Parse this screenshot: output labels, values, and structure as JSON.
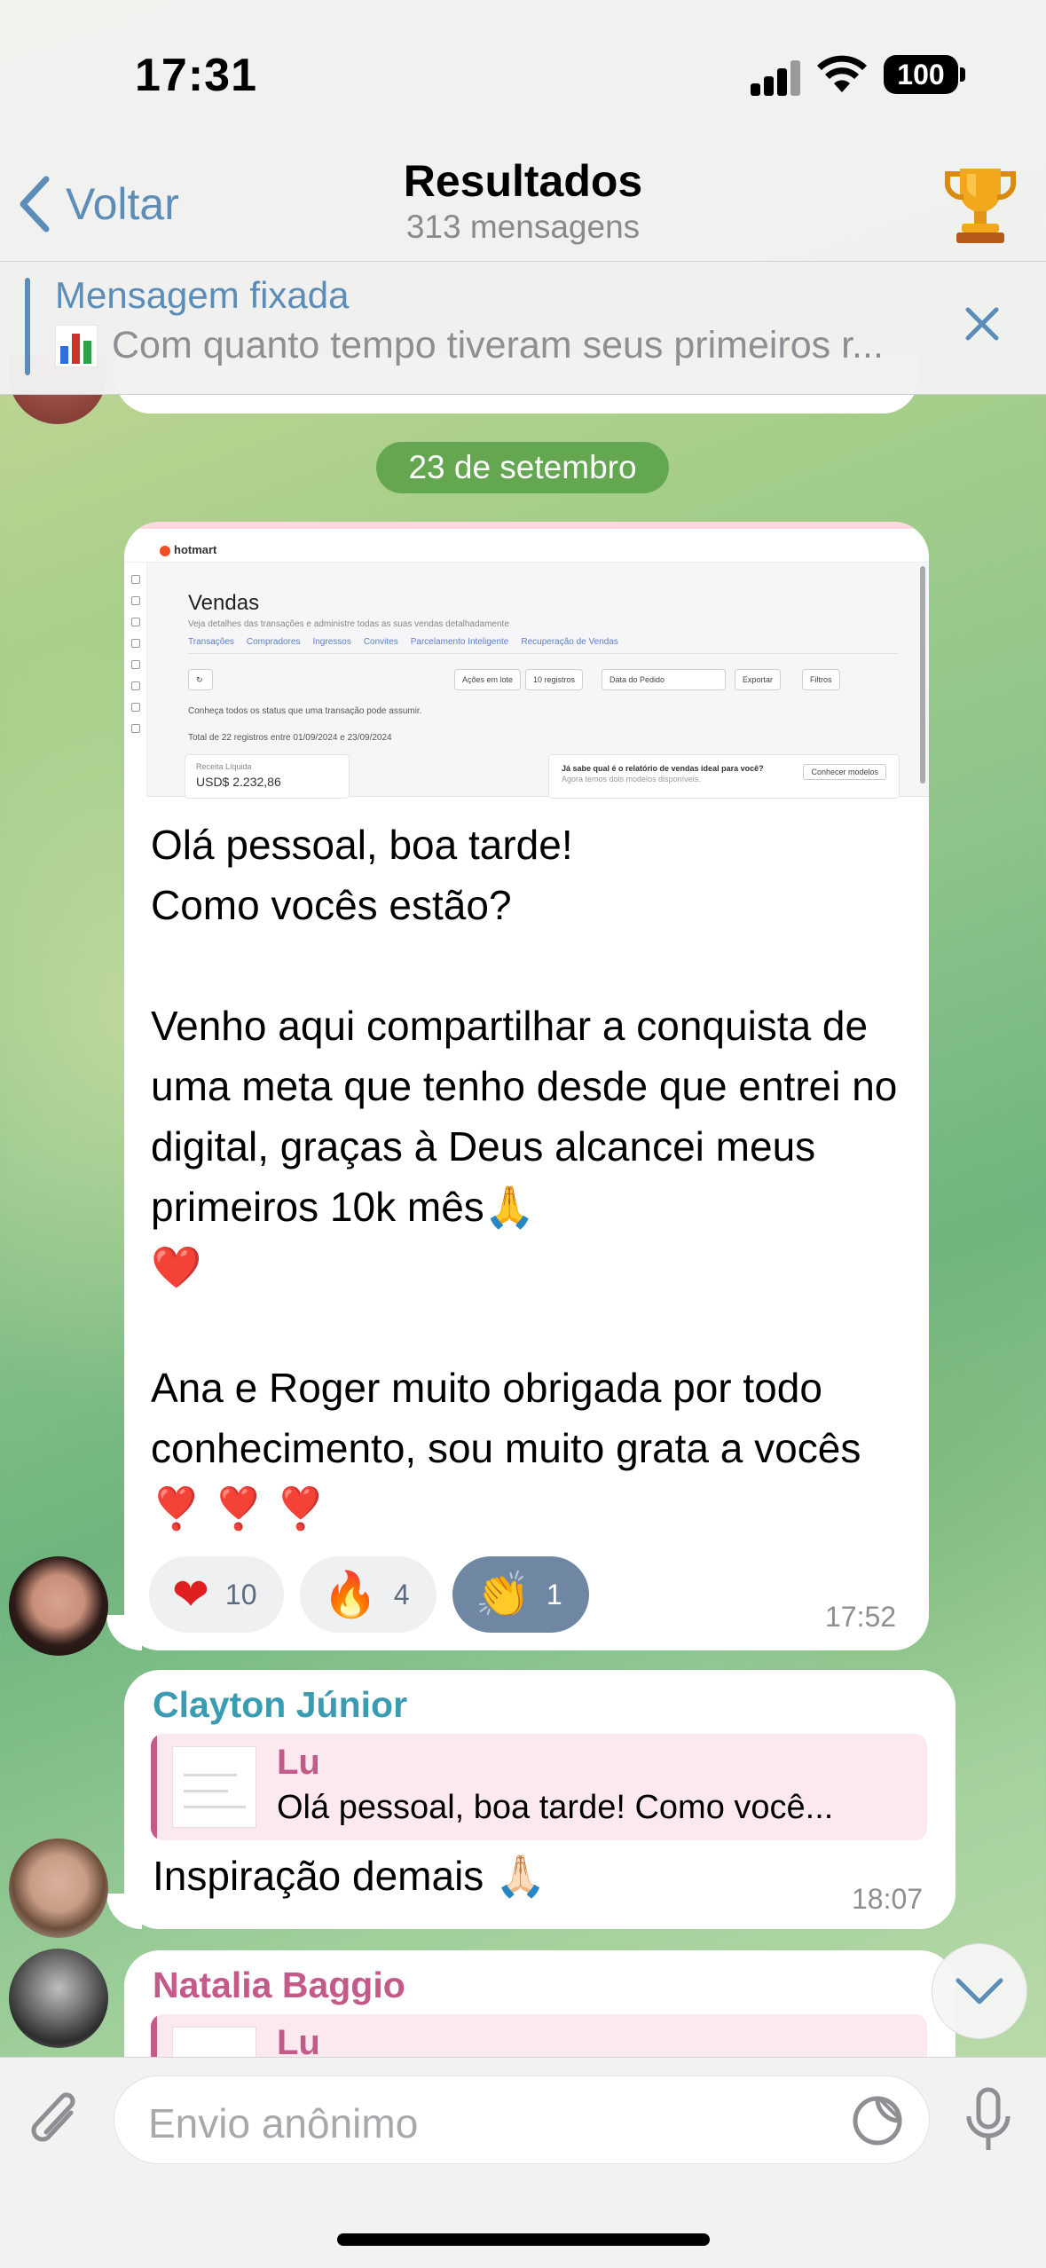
{
  "status_bar": {
    "time": "17:31",
    "battery": "100"
  },
  "nav": {
    "back_label": "Voltar",
    "title": "Resultados",
    "subtitle": "313 mensagens",
    "trophy_icon": "trophy-icon"
  },
  "pinned": {
    "label": "Mensagem fixada",
    "text": "Com quanto tempo tiveram seus primeiros r..."
  },
  "date_divider": "23 de setembro",
  "main_message": {
    "screenshot": {
      "logo": "hotmart",
      "title": "Vendas",
      "subtitle": "Veja detalhes das transações e administre todas as suas vendas detalhadamente",
      "tabs": [
        "Transações",
        "Compradores",
        "Ingressos",
        "Convites",
        "Parcelamento Inteligente",
        "Recuperação de Vendas"
      ],
      "controls": [
        "Ações em lote",
        "10 registros",
        "Data do Pedido",
        "Exportar",
        "Filtros"
      ],
      "status_line": "Conheça todos os status que uma transação pode assumir.",
      "total_line": "Total de 22 registros entre 01/09/2024 e 23/09/2024",
      "receita_label": "Receita Líquida",
      "receita_value": "USD$ 2.232,86",
      "promo_title": "Já sabe qual é o relatório de vendas ideal para você?",
      "promo_sub": "Agora temos dois modelos disponíveis.",
      "promo_button": "Conhecer modelos"
    },
    "text": "Olá pessoal, boa tarde!\nComo vocês estão?\n\nVenho aqui compartilhar a conquista de uma meta que tenho desde que entrei no digital, graças à Deus alcancei meus primeiros 10k mês🙏\n❤️\n\nAna e Roger muito obrigada por todo conhecimento, sou muito grata a vocês ❣️ ❣️ ❣️",
    "reactions": [
      {
        "emoji": "❤",
        "count": "10"
      },
      {
        "emoji": "🔥",
        "count": "4"
      },
      {
        "emoji": "👏",
        "count": "1"
      }
    ],
    "time": "17:52"
  },
  "reply_message": {
    "sender": "Clayton Júnior",
    "sender_color": "#3a9bb3",
    "quote_name": "Lu",
    "quote_text": "Olá pessoal, boa tarde! Como você...",
    "text": "Inspiração demais 🙏🏻",
    "time": "18:07"
  },
  "third_message": {
    "sender": "Natalia Baggio",
    "sender_color": "#c45a8a",
    "quote_name": "Lu"
  },
  "input": {
    "placeholder": "Envio anônimo"
  },
  "colors": {
    "accent": "#5b8db8",
    "date_pill": "#58a046",
    "reaction_active": "#6f87a3"
  }
}
